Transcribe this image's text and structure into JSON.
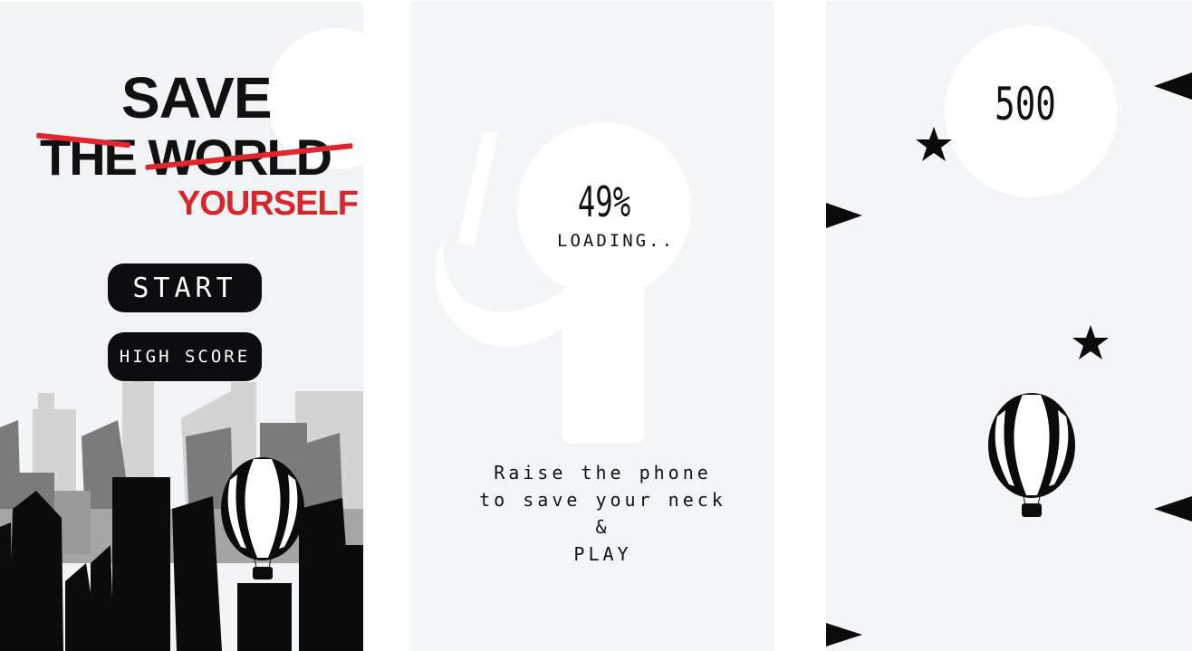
{
  "menu": {
    "logo_line1": "SAVE",
    "logo_line2": "THE WORLD",
    "logo_line3": "YOURSELF",
    "start_label": "START",
    "high_score_label": "HIGH SCORE"
  },
  "loading": {
    "percent_text": "49%",
    "progress": 0.49,
    "label": "LOADING..",
    "instruction_line1": "Raise the phone",
    "instruction_line2": "to save your neck",
    "instruction_line3": "&",
    "instruction_line4": "PLAY"
  },
  "game": {
    "score": "500"
  },
  "colors": {
    "accent_red": "#e0272e",
    "button_bg": "#0d0d0f",
    "panel_bg": "#f4f5f7"
  },
  "icons": [
    "balloon-icon",
    "star-icon",
    "arrow-icon",
    "city-skyline",
    "person-silhouette"
  ]
}
